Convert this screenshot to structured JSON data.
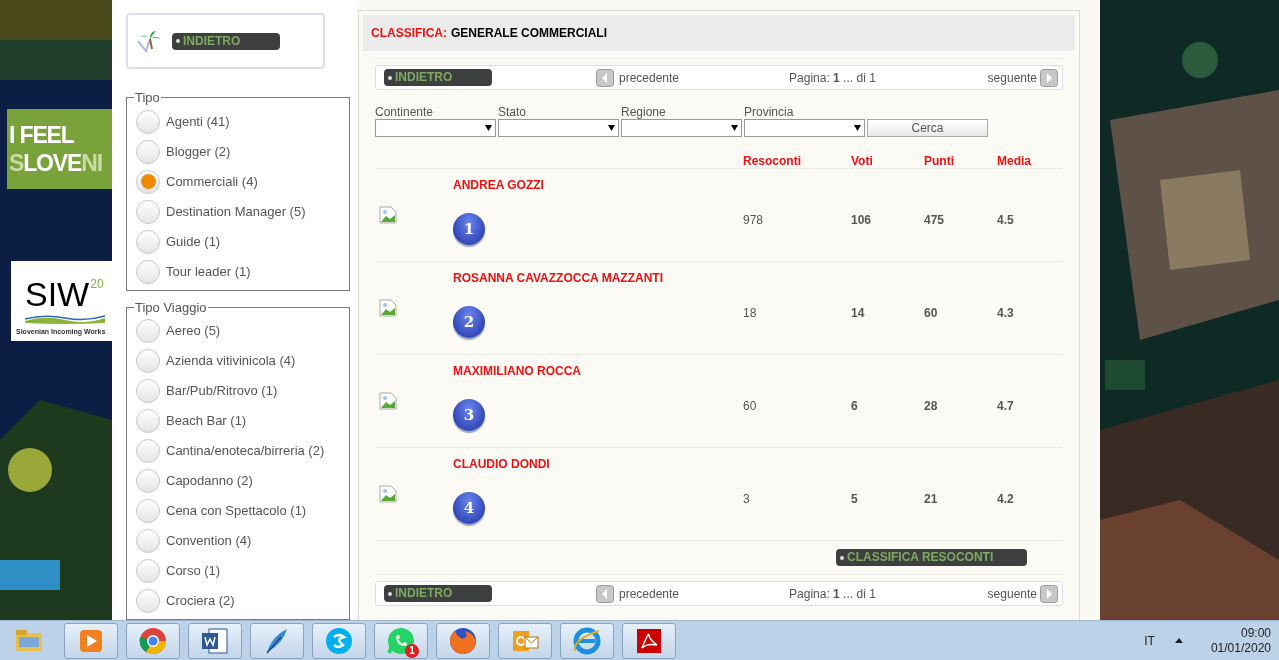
{
  "banner": {
    "line1": "I FEEL",
    "line2": {
      "pre": "S",
      "mid": "LOVE",
      "post": "NI"
    }
  },
  "logo": {
    "mark": "SIW",
    "year": "20",
    "tagline": "Slovenian Incoming Works"
  },
  "sidebar": {
    "back_button": "INDIETRO",
    "groups": [
      {
        "legend": "Tipo",
        "options": [
          {
            "label": "Agenti (41)",
            "selected": false
          },
          {
            "label": "Blogger (2)",
            "selected": false
          },
          {
            "label": "Commerciali (4)",
            "selected": true
          },
          {
            "label": "Destination Manager (5)",
            "selected": false
          },
          {
            "label": "Guide (1)",
            "selected": false
          },
          {
            "label": "Tour leader (1)",
            "selected": false
          }
        ]
      },
      {
        "legend": "Tipo Viaggio",
        "options": [
          {
            "label": "Aereo (5)",
            "selected": false
          },
          {
            "label": "Azienda vitivinicola (4)",
            "selected": false
          },
          {
            "label": "Bar/Pub/Ritrovo (1)",
            "selected": false
          },
          {
            "label": "Beach Bar (1)",
            "selected": false
          },
          {
            "label": "Cantina/enoteca/birreria (2)",
            "selected": false
          },
          {
            "label": "Capodanno (2)",
            "selected": false
          },
          {
            "label": "Cena con Spettacolo (1)",
            "selected": false
          },
          {
            "label": "Convention (4)",
            "selected": false
          },
          {
            "label": "Corso (1)",
            "selected": false
          },
          {
            "label": "Crociera (2)",
            "selected": false
          }
        ]
      }
    ]
  },
  "main": {
    "title": {
      "prefix": "CLASSIFICA:",
      "text": "GENERALE COMMERCIALI"
    },
    "pagers": [
      {
        "back": "INDIETRO",
        "prev": "precedente",
        "page": "Pagina: **1** ... di 1",
        "next": "seguente"
      },
      {
        "back": "INDIETRO",
        "prev": "precedente",
        "page": "Pagina: **1** ... di 1",
        "next": "seguente"
      }
    ],
    "filters": [
      {
        "label": "Continente"
      },
      {
        "label": "Stato"
      },
      {
        "label": "Regione"
      },
      {
        "label": "Provincia"
      }
    ],
    "search_button": "Cerca",
    "columns": [
      "Resoconti",
      "Voti",
      "Punti",
      "Media"
    ],
    "rows": [
      {
        "name": "ANDREA GOZZI",
        "rank": "1",
        "resoconti": "978",
        "voti": "106",
        "punti": "475",
        "media": "4.5"
      },
      {
        "name": "ROSANNA CAVAZZOCCA MAZZANTI",
        "rank": "2",
        "resoconti": "18",
        "voti": "14",
        "punti": "60",
        "media": "4.3"
      },
      {
        "name": "MAXIMILIANO ROCCA",
        "rank": "3",
        "resoconti": "60",
        "voti": "6",
        "punti": "28",
        "media": "4.7"
      },
      {
        "name": "CLAUDIO DONDI",
        "rank": "4",
        "resoconti": "3",
        "voti": "5",
        "punti": "21",
        "media": "4.2"
      }
    ],
    "report_button": "CLASSIFICA RESOCONTI"
  },
  "taskbar": {
    "apps": [
      {
        "kind": "folder"
      },
      {
        "kind": "player"
      },
      {
        "kind": "wheel"
      },
      {
        "kind": "document"
      },
      {
        "kind": "feather"
      },
      {
        "kind": "chat"
      },
      {
        "kind": "phone",
        "badge": "1"
      },
      {
        "kind": "fox"
      },
      {
        "kind": "mail"
      },
      {
        "kind": "browser"
      },
      {
        "kind": "pdf"
      }
    ],
    "language": "IT",
    "time": "09:00",
    "date": "01/01/2020"
  }
}
